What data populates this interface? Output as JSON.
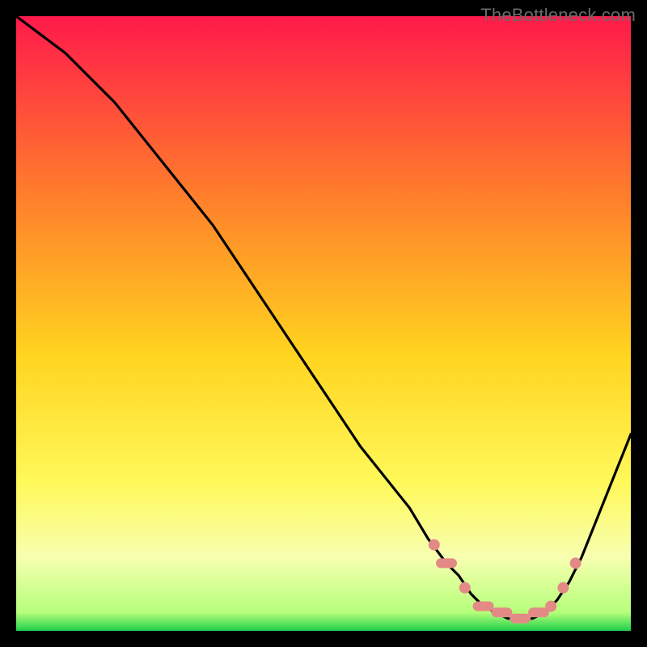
{
  "watermark": "TheBottleneck.com",
  "colors": {
    "background": "#000000",
    "gradient_top": "#ff1a4b",
    "gradient_mid_upper": "#ff7a2c",
    "gradient_mid": "#ffd41f",
    "gradient_mid_lower": "#fff95a",
    "gradient_band": "#f7ffb0",
    "gradient_green": "#1fd04c",
    "curve": "#000000",
    "marker_fill": "#e38a86",
    "marker_stroke": "#b45a55"
  },
  "chart_data": {
    "type": "line",
    "title": "",
    "xlabel": "",
    "ylabel": "",
    "xlim": [
      0,
      100
    ],
    "ylim": [
      0,
      100
    ],
    "series": [
      {
        "name": "bottleneck-curve",
        "x": [
          0,
          4,
          8,
          12,
          16,
          20,
          24,
          28,
          32,
          36,
          40,
          44,
          48,
          52,
          56,
          60,
          64,
          67,
          70,
          72,
          74,
          76,
          78,
          80,
          82,
          84,
          86,
          88,
          90,
          92,
          94,
          96,
          98,
          100
        ],
        "y": [
          100,
          97,
          94,
          90,
          86,
          81,
          76,
          71,
          66,
          60,
          54,
          48,
          42,
          36,
          30,
          25,
          20,
          15,
          11,
          9,
          6,
          4,
          3,
          2,
          2,
          2,
          3,
          5,
          8,
          12,
          17,
          22,
          27,
          32
        ]
      }
    ],
    "markers": {
      "name": "highlight-points",
      "points": [
        {
          "x": 68,
          "y": 14,
          "shape": "circle"
        },
        {
          "x": 70,
          "y": 11,
          "shape": "capsule"
        },
        {
          "x": 73,
          "y": 7,
          "shape": "circle"
        },
        {
          "x": 76,
          "y": 4,
          "shape": "capsule"
        },
        {
          "x": 79,
          "y": 3,
          "shape": "capsule"
        },
        {
          "x": 82,
          "y": 2,
          "shape": "capsule"
        },
        {
          "x": 85,
          "y": 3,
          "shape": "capsule"
        },
        {
          "x": 87,
          "y": 4,
          "shape": "circle"
        },
        {
          "x": 89,
          "y": 7,
          "shape": "circle"
        },
        {
          "x": 91,
          "y": 11,
          "shape": "circle"
        }
      ]
    }
  }
}
